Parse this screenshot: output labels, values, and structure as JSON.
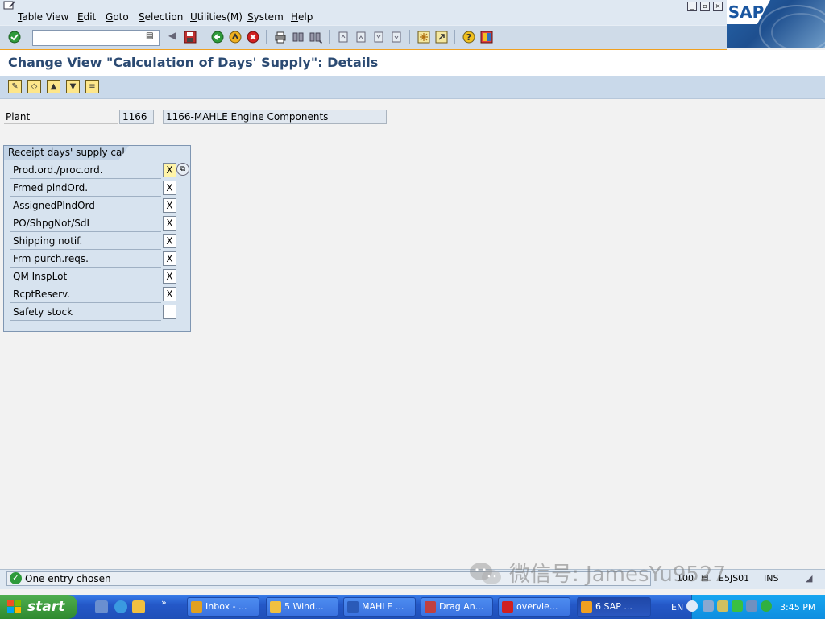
{
  "menu": {
    "items": [
      "Table View",
      "Edit",
      "Goto",
      "Selection",
      "Utilities(M)",
      "System",
      "Help"
    ]
  },
  "toolbar": {
    "command_value": "",
    "icons": [
      "enter-icon",
      "save-icon",
      "back-icon",
      "exit-icon",
      "cancel-icon",
      "print-icon",
      "find-icon",
      "find-next-icon",
      "first-page-icon",
      "prev-page-icon",
      "next-page-icon",
      "last-page-icon",
      "create-session-icon",
      "shortcut-icon",
      "help-icon",
      "layout-icon"
    ]
  },
  "title": "Change View \"Calculation of Days' Supply\": Details",
  "app_toolbar": {
    "icons": [
      "display-change-icon",
      "other-entry-icon",
      "prev-entry-icon",
      "next-entry-icon",
      "variable-list-icon"
    ]
  },
  "plant": {
    "label": "Plant",
    "code": "1166",
    "description": "1166-MAHLE Engine Components"
  },
  "group": {
    "title": "Receipt days' supply cal.",
    "rows": [
      {
        "label": "Prod.ord./proc.ord.",
        "value": "X"
      },
      {
        "label": "Frmed plndOrd.",
        "value": "X"
      },
      {
        "label": "AssignedPlndOrd",
        "value": "X"
      },
      {
        "label": "PO/ShpgNot/SdL",
        "value": "X"
      },
      {
        "label": "Shipping notif.",
        "value": "X"
      },
      {
        "label": "Frm purch.reqs.",
        "value": "X"
      },
      {
        "label": "QM InspLot",
        "value": "X"
      },
      {
        "label": "RcptReserv.",
        "value": "X"
      },
      {
        "label": "Safety stock",
        "value": ""
      }
    ]
  },
  "status": {
    "message": "One entry chosen",
    "client": "100",
    "server": "E5JS01",
    "mode": "INS"
  },
  "watermark": "微信号: JamesYu9527",
  "taskbar": {
    "start": "start",
    "tasks": [
      {
        "label": "Inbox - ...",
        "color": "#e0a020"
      },
      {
        "label": "5 Wind...",
        "color": "#f0c040"
      },
      {
        "label": "MAHLE ...",
        "color": "#2a5ab8"
      },
      {
        "label": "Drag An...",
        "color": "#c04040"
      },
      {
        "label": "overvie...",
        "color": "#d02020"
      },
      {
        "label": "6 SAP ...",
        "color": "#f0a020"
      }
    ],
    "language": "EN",
    "clock": "3:45 PM"
  },
  "colors": {
    "title": "#2b4a72",
    "toolbar_accent": "#f0a020",
    "group_bg": "#d7e3ef",
    "focused_field": "#fff4a8",
    "taskbar": "#2458c8",
    "start": "#2f8a2f"
  }
}
